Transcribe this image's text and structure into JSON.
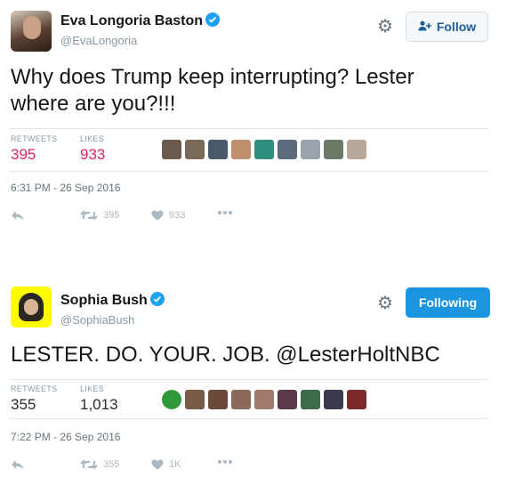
{
  "tweets": [
    {
      "name": "Eva Longoria Baston",
      "handle": "@EvaLongoria",
      "follow_label": "Follow",
      "text": "Why does Trump keep interrupting? Lester where are you?!!!",
      "retweets_label": "RETWEETS",
      "retweets": "395",
      "likes_label": "LIKES",
      "likes": "933",
      "timestamp": "6:31 PM - 26 Sep 2016",
      "retweet_count": "395",
      "like_count": "933",
      "liker_colors": [
        "#6b5a4e",
        "#7c6a58",
        "#4a5a6a",
        "#c08f6f",
        "#2f8f7f",
        "#5b6b7b",
        "#9aa3ab",
        "#6d7a6a",
        "#b9a89a"
      ]
    },
    {
      "name": "Sophia Bush",
      "handle": "@SophiaBush",
      "follow_label": "Following",
      "text": "LESTER. DO. YOUR. JOB. @LesterHoltNBC",
      "retweets_label": "RETWEETS",
      "retweets": "355",
      "likes_label": "LIKES",
      "likes": "1,013",
      "timestamp": "7:22 PM - 26 Sep 2016",
      "retweet_count": "355",
      "like_count": "1K",
      "liker_colors": [
        "#2e9a3a",
        "#7a5c46",
        "#6b4a3a",
        "#8a6a5a",
        "#a07a6a",
        "#5a3a4a",
        "#3c6a4a",
        "#3a3a4a",
        "#7a2a2a"
      ]
    }
  ],
  "colors": {
    "link": "#1b95e0",
    "red_counts": "#e0245e",
    "verified": "#1da1f2"
  }
}
